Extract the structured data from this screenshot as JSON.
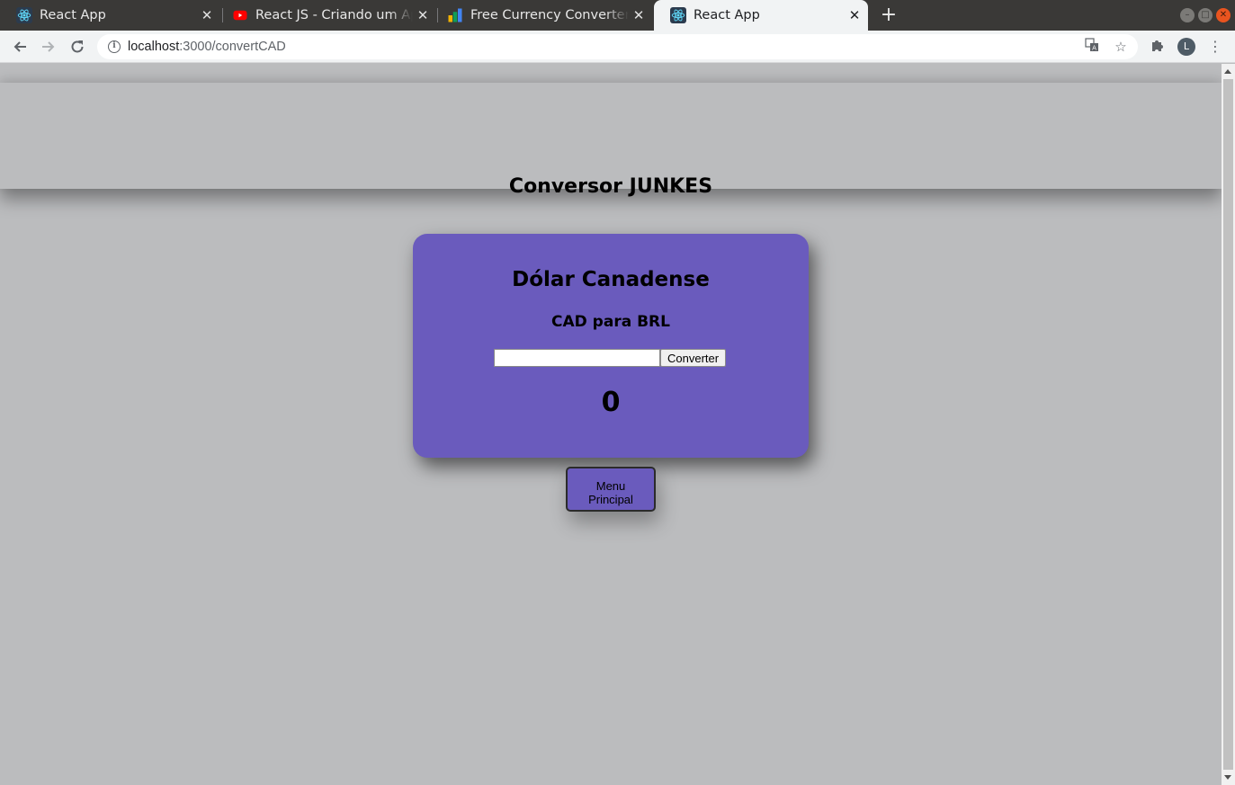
{
  "browser": {
    "tabs": [
      {
        "title": "React App",
        "favicon": "react-icon",
        "active": false
      },
      {
        "title": "React JS - Criando um App",
        "favicon": "youtube-icon",
        "active": false
      },
      {
        "title": "Free Currency Converter A",
        "favicon": "currency-converter-icon",
        "active": false
      },
      {
        "title": "React App",
        "favicon": "react-icon",
        "active": true
      }
    ],
    "close_glyph": "✕",
    "new_tab_glyph": "+",
    "url_host": "localhost",
    "url_rest": ":3000/convertCAD",
    "profile_initial": "L"
  },
  "page": {
    "header_title": "Conversor JUNKES",
    "card": {
      "title": "Dólar Canadense",
      "subtitle": "CAD para BRL",
      "input_value": "",
      "convert_label": "Converter",
      "result": "0"
    },
    "menu_button_line1": "Menu",
    "menu_button_line2": "Principal"
  },
  "colors": {
    "page_background": "#bbbcbe",
    "card_background": "#6a5bbd",
    "tabbar_background": "#3a3937"
  }
}
